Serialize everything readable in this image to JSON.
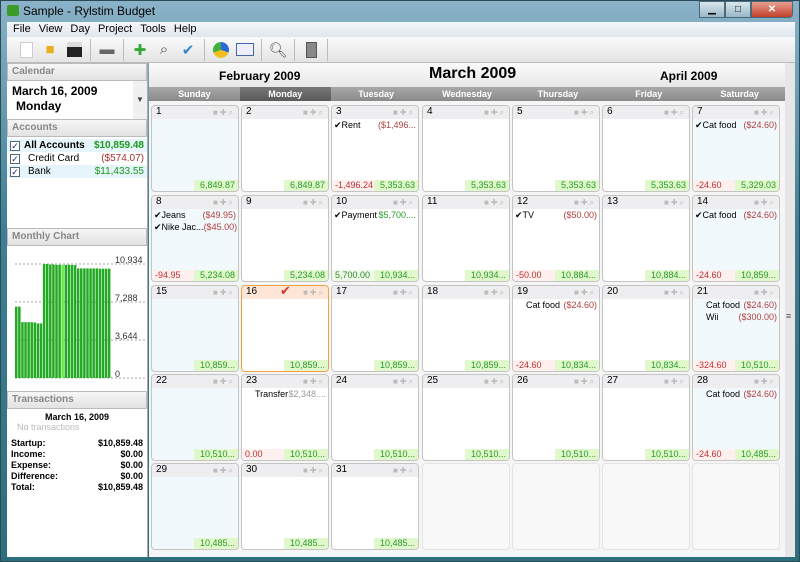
{
  "window": {
    "title": "Sample - Rylstim Budget"
  },
  "menu": [
    "File",
    "View",
    "Day",
    "Project",
    "Tools",
    "Help"
  ],
  "toolbar": [
    "new-file-icon",
    "open-folder-icon",
    "save-icon",
    "print-icon",
    "add-transaction-icon",
    "find-transaction-icon",
    "check-transaction-icon",
    "pie-chart-icon",
    "line-chart-icon",
    "search-icon",
    "calculator-icon"
  ],
  "sidebar": {
    "calendar_label": "Calendar",
    "date": "March 16, 2009",
    "weekday": "Monday",
    "accounts_label": "Accounts",
    "accounts": [
      {
        "name": "All Accounts",
        "balance": "$10,859.48",
        "checked": true
      },
      {
        "name": "Credit Card",
        "balance": "($574.07)",
        "checked": true
      },
      {
        "name": "Bank",
        "balance": "$11,433.55",
        "checked": true
      }
    ],
    "chart_label": "Monthly Chart",
    "transactions_label": "Transactions",
    "tx_date": "March 16, 2009",
    "no_tx": "No transactions",
    "summary": [
      {
        "label": "Startup:",
        "value": "$10,859.48"
      },
      {
        "label": "Income:",
        "value": "$0.00"
      },
      {
        "label": "Expense:",
        "value": "$0.00"
      },
      {
        "label": "Difference:",
        "value": "$0.00"
      },
      {
        "label": "Total:",
        "value": "$10,859.48"
      }
    ]
  },
  "chart_data": {
    "type": "bar",
    "categories": [
      1,
      2,
      3,
      4,
      5,
      6,
      7,
      8,
      9,
      10,
      11,
      12,
      13,
      14,
      15,
      16,
      17,
      18,
      19,
      20,
      21,
      22,
      23,
      24,
      25,
      26,
      27,
      28,
      29,
      30,
      31
    ],
    "values": [
      6849.87,
      6849.87,
      5353.63,
      5353.63,
      5353.63,
      5353.63,
      5329.03,
      5234.08,
      5234.08,
      10934,
      10934,
      10884,
      10884,
      10859,
      10859,
      10859,
      10859,
      10859,
      10834,
      10834,
      10510,
      10510,
      10510,
      10510,
      10510,
      10510,
      10510,
      10485,
      10485,
      10485,
      10485
    ],
    "ticks": [
      "10,934",
      "7,288",
      "3,644",
      "0"
    ],
    "ylim": [
      0,
      10934
    ],
    "highlight_day": 16,
    "color": "#22aa22"
  },
  "calendar": {
    "prev_month": "February 2009",
    "month": "March 2009",
    "next_month": "April 2009",
    "weekdays": [
      "Sunday",
      "Monday",
      "Tuesday",
      "Wednesday",
      "Thursday",
      "Friday",
      "Saturday"
    ],
    "current_weekday": 1,
    "today": 16,
    "days": [
      {
        "d": "1",
        "bal": "6,849.87"
      },
      {
        "d": "2",
        "bal": "6,849.87"
      },
      {
        "d": "3",
        "tx": [
          {
            "c": true,
            "l": "Rent",
            "a": "($1,496...",
            "t": "out"
          }
        ],
        "diff": "-1,496.24",
        "bal": "5,353.63"
      },
      {
        "d": "4",
        "bal": "5,353.63"
      },
      {
        "d": "5",
        "bal": "5,353.63"
      },
      {
        "d": "6",
        "bal": "5,353.63"
      },
      {
        "d": "7",
        "tx": [
          {
            "c": true,
            "l": "Cat food",
            "a": "($24.60)",
            "t": "out"
          }
        ],
        "diff": "-24.60",
        "bal": "5,329.03"
      },
      {
        "d": "8",
        "tx": [
          {
            "c": true,
            "l": "Jeans",
            "a": "($49.95)",
            "t": "out"
          },
          {
            "c": true,
            "l": "Nike Jac...",
            "a": "($45.00)",
            "t": "out"
          }
        ],
        "diff": "-94.95",
        "bal": "5,234.08"
      },
      {
        "d": "9",
        "bal": "5,234.08"
      },
      {
        "d": "10",
        "tx": [
          {
            "c": true,
            "l": "Payment",
            "a": "$5,700....",
            "t": "in"
          }
        ],
        "diff": "5,700.00",
        "dpos": true,
        "bal": "10,934..."
      },
      {
        "d": "11",
        "bal": "10,934..."
      },
      {
        "d": "12",
        "tx": [
          {
            "c": true,
            "l": "TV",
            "a": "($50.00)",
            "t": "out"
          }
        ],
        "diff": "-50.00",
        "bal": "10,884..."
      },
      {
        "d": "13",
        "bal": "10,884..."
      },
      {
        "d": "14",
        "tx": [
          {
            "c": true,
            "l": "Cat food",
            "a": "($24.60)",
            "t": "out"
          }
        ],
        "diff": "-24.60",
        "bal": "10,859..."
      },
      {
        "d": "15",
        "bal": "10,859..."
      },
      {
        "d": "16",
        "bal": "10,859..."
      },
      {
        "d": "17",
        "bal": "10,859..."
      },
      {
        "d": "18",
        "bal": "10,859..."
      },
      {
        "d": "19",
        "tx": [
          {
            "c": false,
            "l": "Cat food",
            "a": "($24.60)",
            "t": "out"
          }
        ],
        "diff": "-24.60",
        "bal": "10,834..."
      },
      {
        "d": "20",
        "bal": "10,834..."
      },
      {
        "d": "21",
        "tx": [
          {
            "c": false,
            "l": "Cat food",
            "a": "($24.60)",
            "t": "out"
          },
          {
            "c": false,
            "l": "Wii",
            "a": "($300.00)",
            "t": "out"
          }
        ],
        "diff": "-324.60",
        "bal": "10,510..."
      },
      {
        "d": "22",
        "bal": "10,510..."
      },
      {
        "d": "23",
        "tx": [
          {
            "c": false,
            "l": "Transfer",
            "a": "$2,348....",
            "t": "gr"
          }
        ],
        "diff": "0.00",
        "bal": "10,510..."
      },
      {
        "d": "24",
        "bal": "10,510..."
      },
      {
        "d": "25",
        "bal": "10,510..."
      },
      {
        "d": "26",
        "bal": "10,510..."
      },
      {
        "d": "27",
        "bal": "10,510..."
      },
      {
        "d": "28",
        "tx": [
          {
            "c": false,
            "l": "Cat food",
            "a": "($24.60)",
            "t": "out"
          }
        ],
        "diff": "-24.60",
        "bal": "10,485..."
      },
      {
        "d": "29",
        "bal": "10,485..."
      },
      {
        "d": "30",
        "bal": "10,485..."
      },
      {
        "d": "31",
        "bal": "10,485..."
      }
    ]
  }
}
